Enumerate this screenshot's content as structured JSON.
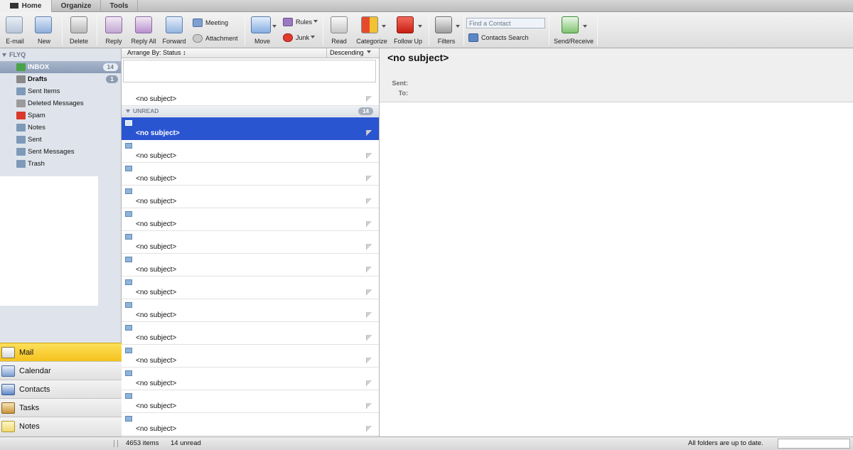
{
  "tabs": [
    {
      "label": "Home",
      "active": true
    },
    {
      "label": "Organize",
      "active": false
    },
    {
      "label": "Tools",
      "active": false
    }
  ],
  "ribbon": {
    "email": "E-mail",
    "new": "New",
    "delete": "Delete",
    "reply": "Reply",
    "reply_all": "Reply All",
    "forward": "Forward",
    "meeting": "Meeting",
    "attachment": "Attachment",
    "move": "Move",
    "rules": "Rules",
    "junk": "Junk",
    "read": "Read",
    "categorize": "Categorize",
    "follow_up": "Follow Up",
    "filters": "Filters",
    "find_contact_placeholder": "Find a Contact",
    "contacts_search": "Contacts Search",
    "send_receive": "Send/Receive"
  },
  "sidebar": {
    "account": "FLYQ",
    "folders": [
      {
        "label": "INBOX",
        "count": "14",
        "selected": true
      },
      {
        "label": "Drafts",
        "count": "1",
        "bold": true
      },
      {
        "label": "Sent Items"
      },
      {
        "label": "Deleted Messages"
      },
      {
        "label": "Spam"
      },
      {
        "label": "Notes"
      },
      {
        "label": "Sent"
      },
      {
        "label": "Sent Messages"
      },
      {
        "label": "Trash"
      }
    ],
    "nav": [
      {
        "label": "Mail",
        "selected": true
      },
      {
        "label": "Calendar"
      },
      {
        "label": "Contacts"
      },
      {
        "label": "Tasks"
      },
      {
        "label": "Notes"
      }
    ]
  },
  "list": {
    "arrange_by": "Arrange By: Status",
    "order": "Descending",
    "top_item": "<no subject>",
    "group_label": "UNREAD",
    "group_count": "14",
    "messages": [
      {
        "subject": "<no subject>",
        "selected": true
      },
      {
        "subject": "<no subject>"
      },
      {
        "subject": "<no subject>"
      },
      {
        "subject": "<no subject>"
      },
      {
        "subject": "<no subject>"
      },
      {
        "subject": "<no subject>"
      },
      {
        "subject": "<no subject>"
      },
      {
        "subject": "<no subject>"
      },
      {
        "subject": "<no subject>"
      },
      {
        "subject": "<no subject>"
      },
      {
        "subject": "<no subject>"
      },
      {
        "subject": "<no subject>"
      },
      {
        "subject": "<no subject>"
      },
      {
        "subject": "<no subject>"
      }
    ]
  },
  "reading": {
    "subject": "<no subject>",
    "sent_label": "Sent:",
    "to_label": "To:"
  },
  "status": {
    "items": "4653 items",
    "unread": "14 unread",
    "sync": "All folders are up to date."
  },
  "colors": {
    "selection": "#2a55d1",
    "mail_nav": "#f5c21d",
    "sidebar_bg": "#dfe4ec"
  }
}
